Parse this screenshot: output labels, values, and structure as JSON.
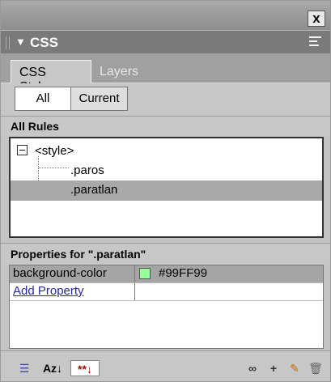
{
  "window": {
    "close_glyph": "x"
  },
  "group": {
    "title": "CSS",
    "caret_glyph": "▼"
  },
  "tabs": [
    {
      "label": "CSS Styles",
      "active": true
    },
    {
      "label": "Layers",
      "active": false
    }
  ],
  "views": [
    {
      "label": "All",
      "selected": true
    },
    {
      "label": "Current",
      "selected": false
    }
  ],
  "rules": {
    "section_label": "All Rules",
    "root": "<style>",
    "items": [
      {
        "label": ".paros",
        "selected": false
      },
      {
        "label": ".paratlan",
        "selected": true
      }
    ]
  },
  "properties": {
    "header": "Properties for \".paratlan\"",
    "rows": [
      {
        "name": "background-color",
        "value": "#99FF99",
        "swatch_color": "#99FF99"
      }
    ],
    "add_label": "Add Property"
  },
  "toolbar": {
    "left_tools": [
      {
        "icon": "category-view-icon",
        "glyph": "☰"
      },
      {
        "icon": "alphabetical-view-icon",
        "glyph": "Az↓"
      },
      {
        "icon": "set-properties-view-icon",
        "glyph": "**↓"
      }
    ],
    "right_tools": [
      {
        "icon": "attach-stylesheet-icon",
        "glyph": "∞"
      },
      {
        "icon": "new-css-rule-icon",
        "glyph": "+"
      },
      {
        "icon": "edit-style-icon",
        "glyph": "✎"
      },
      {
        "icon": "delete-css-rule-icon",
        "glyph": "🗑"
      }
    ]
  },
  "colors": {
    "swatch": "#99FF99",
    "selection": "#a9a9a9",
    "link": "#2a2a9a"
  }
}
